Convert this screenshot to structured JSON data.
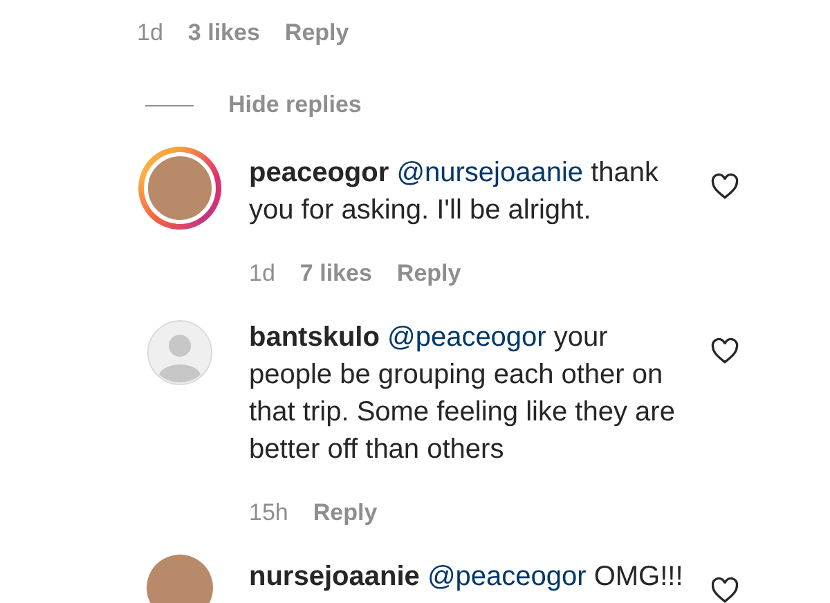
{
  "top_meta": {
    "time": "1d",
    "likes": "3 likes",
    "reply": "Reply"
  },
  "hide_replies": "Hide replies",
  "comments": [
    {
      "username": "peaceogor",
      "mention": "@nursejoaanie",
      "text": " thank you for asking. I'll be alright.",
      "kind": "photo",
      "story_ring": true,
      "time": "1d",
      "likes": "7 likes",
      "reply": "Reply"
    },
    {
      "username": "bantskulo",
      "mention": "@peaceogor",
      "text": " your people be grouping each other on that trip. Some feeling like they are better off than others",
      "kind": "default",
      "story_ring": false,
      "time": "15h",
      "reply": "Reply"
    },
    {
      "username": "nursejoaanie",
      "mention": "@peaceogor",
      "text": " OMG!!!",
      "kind": "photo",
      "story_ring": false
    }
  ]
}
